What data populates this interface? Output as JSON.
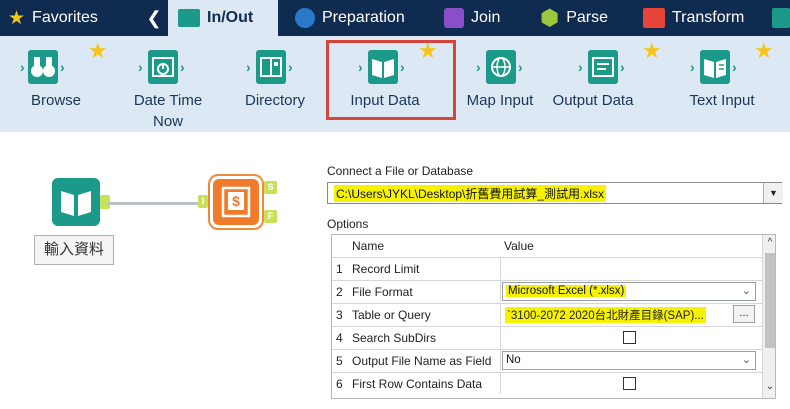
{
  "tabs": [
    {
      "label": "Favorites",
      "icon": "star-icon"
    },
    {
      "label": "In/Out",
      "icon": "folder-icon",
      "active": true
    },
    {
      "label": "Preparation",
      "icon": "circle-icon"
    },
    {
      "label": "Join",
      "icon": "square-icon"
    },
    {
      "label": "Parse",
      "icon": "hexagon-icon"
    },
    {
      "label": "Transform",
      "icon": "flag-icon"
    }
  ],
  "tab_back_glyph": "❮",
  "tools": [
    {
      "label": "Browse",
      "icon": "binoculars-icon",
      "starred": true
    },
    {
      "label": "Date Time Now",
      "icon": "clock-icon",
      "starred": false
    },
    {
      "label": "Directory",
      "icon": "directory-icon",
      "starred": false
    },
    {
      "label": "Input Data",
      "icon": "book-icon",
      "starred": true
    },
    {
      "label": "Map Input",
      "icon": "globe-icon",
      "starred": false
    },
    {
      "label": "Output Data",
      "icon": "output-icon",
      "starred": true
    },
    {
      "label": "Text Input",
      "icon": "text-input-icon",
      "starred": true
    }
  ],
  "canvas": {
    "input_node_label": "輸入資料",
    "output_anchor_s": "S",
    "output_anchor_f": "F",
    "output_anchor_i": "I"
  },
  "config": {
    "connect_label": "Connect a File or Database",
    "file_path": "C:\\Users\\JYKL\\Desktop\\折舊費用試算_測試用.xlsx",
    "options_label": "Options",
    "columns": [
      "Name",
      "Value"
    ],
    "rows": [
      {
        "num": "1",
        "name": "Record Limit",
        "value": "",
        "type": "text"
      },
      {
        "num": "2",
        "name": "File Format",
        "value": "Microsoft Excel (*.xlsx)",
        "type": "select"
      },
      {
        "num": "3",
        "name": "Table or Query",
        "value": "`3100-2072  2020台北財產目錄(SAP)...",
        "type": "query"
      },
      {
        "num": "4",
        "name": "Search SubDirs",
        "value": "",
        "type": "checkbox"
      },
      {
        "num": "5",
        "name": "Output File Name as Field",
        "value": "No",
        "type": "select"
      },
      {
        "num": "6",
        "name": "First Row Contains Data",
        "value": "",
        "type": "checkbox"
      }
    ],
    "ellipsis": "..."
  },
  "colors": {
    "tab_bar": "#102b50",
    "ribbon": "#dce8f4",
    "teal": "#1b9a8a",
    "orange": "#f07b2b",
    "highlight": "#f7f300",
    "selection_border": "#d9443a",
    "star": "#f5c518"
  }
}
